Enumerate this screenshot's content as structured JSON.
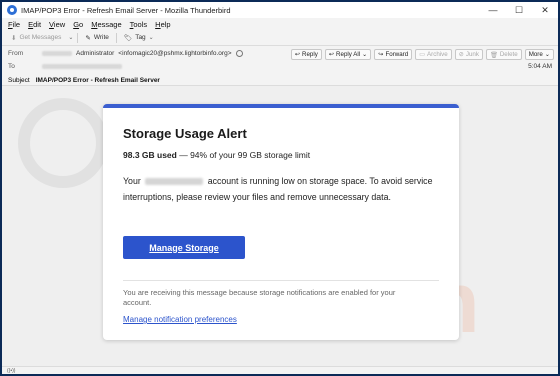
{
  "window": {
    "title": "IMAP/POP3 Error - Refresh Email Server - Mozilla Thunderbird",
    "controls": {
      "minimize": "—",
      "maximize": "☐",
      "close": "✕"
    }
  },
  "menu": [
    "File",
    "Edit",
    "View",
    "Go",
    "Message",
    "Tools",
    "Help"
  ],
  "toolbar": {
    "get_messages": "Get Messages",
    "write": "Write",
    "tag": "Tag"
  },
  "header": {
    "from_label": "From",
    "from_name": "Administrator",
    "from_email": "<infomagic20@pshmx.lightorbinfo.org>",
    "to_label": "To",
    "subject_label": "Subject",
    "subject": "IMAP/POP3 Error - Refresh Email Server",
    "time": "5:04 AM",
    "actions": {
      "reply": "Reply",
      "reply_all": "Reply All",
      "forward": "Forward",
      "archive": "Archive",
      "junk": "Junk",
      "delete": "Delete",
      "more": "More"
    }
  },
  "email": {
    "heading": "Storage Usage Alert",
    "usage_bold": "98.3 GB used",
    "usage_rest": " — 94% of your 99 GB storage limit",
    "para_prefix": "Your",
    "para_suffix": "account is running low on storage space. To avoid service interruptions, please review your files and remove unnecessary data.",
    "button": "Manage Storage",
    "notice": "You are receiving this message because storage notifications are enabled for your account.",
    "pref_link": "Manage notification preferences"
  },
  "colors": {
    "accent": "#2c54cc",
    "card_top_border": "#3b5fd0",
    "outer_frame": "#0b2a57"
  }
}
